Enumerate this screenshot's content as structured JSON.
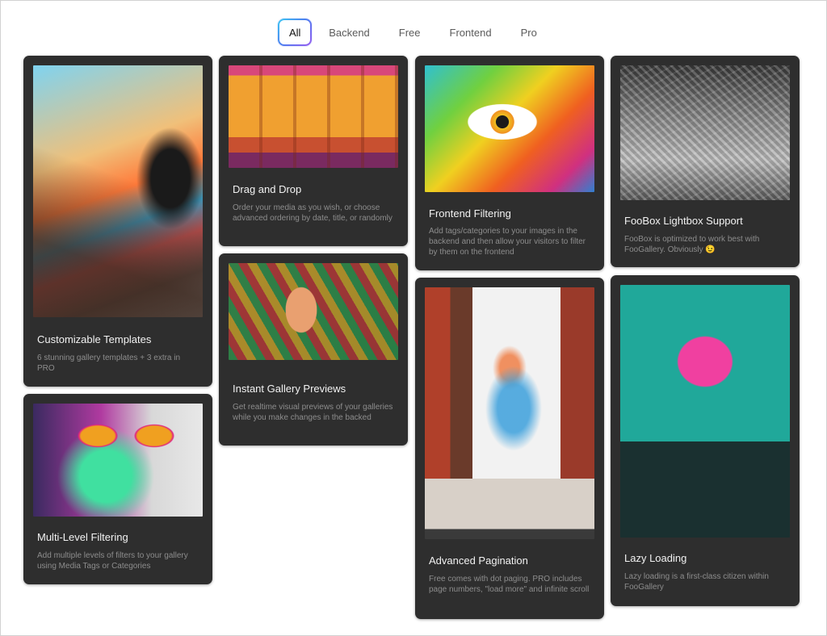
{
  "filters": {
    "tabs": [
      {
        "label": "All",
        "active": true
      },
      {
        "label": "Backend",
        "active": false
      },
      {
        "label": "Free",
        "active": false
      },
      {
        "label": "Frontend",
        "active": false
      },
      {
        "label": "Pro",
        "active": false
      }
    ]
  },
  "cards": [
    {
      "title": "Customizable Templates",
      "description": "6 stunning gallery templates + 3 extra in PRO",
      "image": "street-art-fire-hydrant"
    },
    {
      "title": "Drag and Drop",
      "description": "Order your media as you wish, or choose advanced ordering by date, title, or randomly",
      "image": "colorful-building-facade"
    },
    {
      "title": "Frontend Filtering",
      "description": "Add tags/categories to your images in the backend and then allow your visitors to filter by them on the frontend",
      "image": "eye-mural"
    },
    {
      "title": "FooBox Lightbox Support",
      "description": "FooBox is optimized to work best with FooGallery. Obviously 😉",
      "image": "cyclist-mural"
    },
    {
      "title": "Instant Gallery Previews",
      "description": "Get realtime visual previews of your galleries while you make changes in the backed",
      "image": "face-mosaic-mural"
    },
    {
      "title": "Advanced Pagination",
      "description": "Free comes with dot paging. PRO includes page numbers, \"load more\" and infinite scroll",
      "image": "portrait-mural-building"
    },
    {
      "title": "Lazy Loading",
      "description": "Lazy loading is a first-class citizen within FooGallery",
      "image": "heart-bird-mural"
    },
    {
      "title": "Multi-Level Filtering",
      "description": "Add multiple levels of filters to your gallery using Media Tags or Categories",
      "image": "sunglasses-mural"
    }
  ]
}
